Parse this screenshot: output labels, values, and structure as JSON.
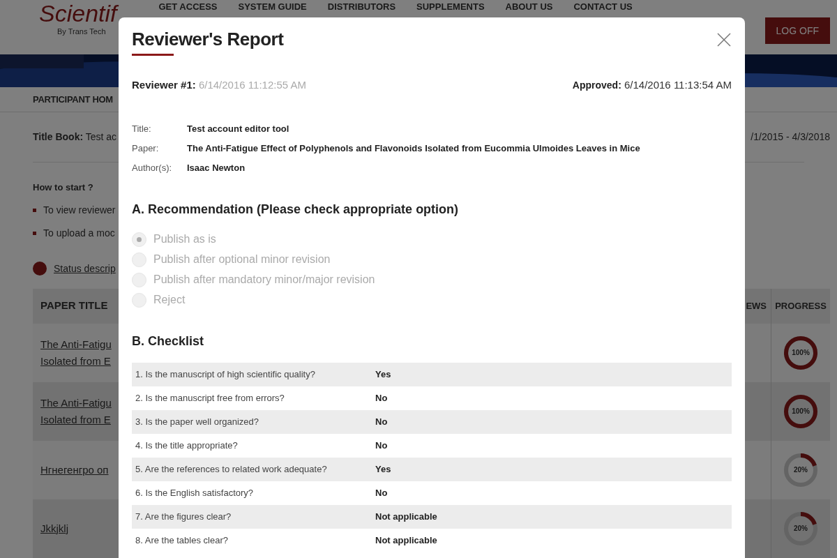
{
  "site": {
    "logo": "Scientif",
    "logo_sub": "By Trans Tech",
    "nav": [
      "GET ACCESS",
      "SYSTEM GUIDE",
      "DISTRIBUTORS",
      "SUPPLEMENTS",
      "ABOUT US",
      "CONTACT US"
    ],
    "logoff": "LOG OFF"
  },
  "page": {
    "heading": "PARTICIPANT HOM",
    "title_book_label": "Title Book:",
    "title_book_value": "Test ac",
    "dates": "/1/2015 - 4/3/2018",
    "how_to": "How to start ?",
    "steps": [
      "To view reviewer",
      "To upload a moc"
    ],
    "status_link": "Status descrip",
    "table": {
      "columns": [
        "PAPER TITLE",
        "EWS",
        "PROGRESS"
      ],
      "rows": [
        {
          "title": [
            "The Anti-Fatigu",
            "Isolated from E"
          ],
          "progress": "100%",
          "level": 1
        },
        {
          "title": [
            "The Anti-Fatigu",
            "Isolated from E"
          ],
          "progress": "100%",
          "level": 1
        },
        {
          "title": [
            "Нгнегенгро оп"
          ],
          "progress": "20%",
          "level": 0.2
        },
        {
          "title": [
            "Jkkjklj"
          ],
          "progress": "20%",
          "level": 0.2
        }
      ]
    }
  },
  "dialog": {
    "title": "Reviewer's Report",
    "reviewer_label": "Reviewer #1:",
    "reviewer_date": "6/14/2016 11:12:55 AM",
    "approved_label": "Approved:",
    "approved_date": "6/14/2016 11:13:54 AM",
    "info": [
      {
        "label": "Title:",
        "value": "Test account editor tool"
      },
      {
        "label": "Paper:",
        "value": "The Anti-Fatigue Effect of Polyphenols and Flavonoids Isolated from Eucommia Ulmoides Leaves in Mice"
      },
      {
        "label": "Author(s):",
        "value": "Isaac Newton"
      }
    ],
    "recommendation_heading": "A. Recommendation (Please check appropriate option)",
    "options": [
      {
        "label": "Publish as is",
        "selected": true
      },
      {
        "label": "Publish after optional minor revision",
        "selected": false
      },
      {
        "label": "Publish after mandatory minor/major revision",
        "selected": false
      },
      {
        "label": "Reject",
        "selected": false
      }
    ],
    "checklist_heading": "B. Checklist",
    "checklist": [
      {
        "question": "1. Is the manuscript of high scientific quality?",
        "answer": "Yes"
      },
      {
        "question": "2. Is the manuscript free from errors?",
        "answer": "No"
      },
      {
        "question": "3. Is the paper well organized?",
        "answer": "No"
      },
      {
        "question": "4. Is the title appropriate?",
        "answer": "No"
      },
      {
        "question": "5. Are the references to related work adequate?",
        "answer": "Yes"
      },
      {
        "question": "6. Is the English satisfactory?",
        "answer": "No"
      },
      {
        "question": "7. Are the figures clear?",
        "answer": "Not applicable"
      },
      {
        "question": "8. Are the tables clear?",
        "answer": "Not applicable"
      }
    ]
  }
}
